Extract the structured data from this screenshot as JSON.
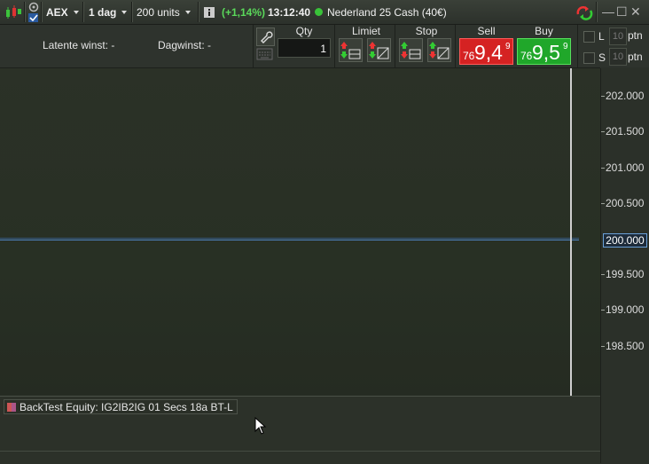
{
  "header": {
    "instrument": "AEX",
    "timeframe": "1 dag",
    "units": "200 units",
    "change": "(+1,14%)",
    "time": "13:12:40",
    "market": "Nederland 25 Cash (40€)"
  },
  "stats": {
    "latent_label": "Latente winst:",
    "latent_value": "-",
    "daily_label": "Dagwinst:",
    "daily_value": "-"
  },
  "order": {
    "qty_label": "Qty",
    "qty_value": "1",
    "limit_label": "Limiet",
    "stop_label": "Stop",
    "sell_label": "Sell",
    "sell_small": "76",
    "sell_big": "9,4",
    "sell_sup": "9",
    "buy_label": "Buy",
    "buy_small": "76",
    "buy_big": "9,5",
    "buy_sup": "9"
  },
  "side_panel": {
    "long_label": "L",
    "short_label": "S",
    "long_ptn_value": "10",
    "short_ptn_value": "10",
    "ptn_label": "ptn"
  },
  "axis": {
    "ticks": [
      "202.000",
      "201.500",
      "201.000",
      "200.500",
      "200.000",
      "199.500",
      "199.000",
      "198.500"
    ],
    "current": "200.000"
  },
  "legend": {
    "label": "BackTest Equity: IG2IB2IG 01 Secs 18a BT-L"
  },
  "colors": {
    "sell": "#d52222",
    "buy": "#20a72a",
    "equity_line": "#4f86c6",
    "positive": "#5ad85a"
  }
}
